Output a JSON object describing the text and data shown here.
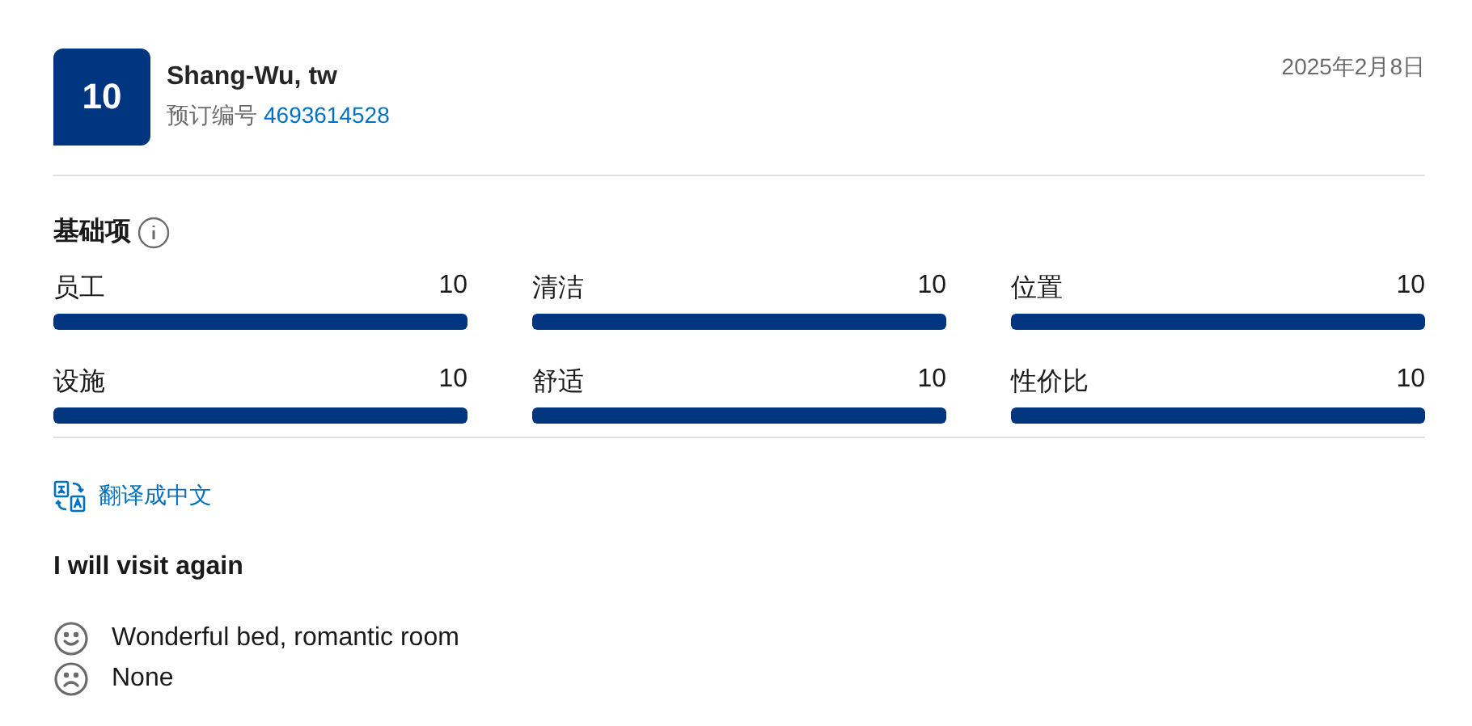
{
  "review": {
    "score": "10",
    "name": "Shang-Wu, tw",
    "booking_label": "预订编号",
    "booking_number": "4693614528",
    "date": "2025年2月8日"
  },
  "categories": {
    "title": "基础项",
    "items": [
      {
        "label": "员工",
        "value": "10",
        "level": 1
      },
      {
        "label": "清洁",
        "value": "10",
        "level": 1
      },
      {
        "label": "位置",
        "value": "10",
        "level": 1
      },
      {
        "label": "设施",
        "value": "10",
        "level": 1
      },
      {
        "label": "舒适",
        "value": "10",
        "level": 1
      },
      {
        "label": "性价比",
        "value": "10",
        "level": 1
      }
    ]
  },
  "translate_link": "翻译成中文",
  "review_title": "I will visit again",
  "comments": [
    {
      "kind": "positive",
      "text": "Wonderful bed, romantic room"
    },
    {
      "kind": "negative",
      "text": "None"
    }
  ]
}
